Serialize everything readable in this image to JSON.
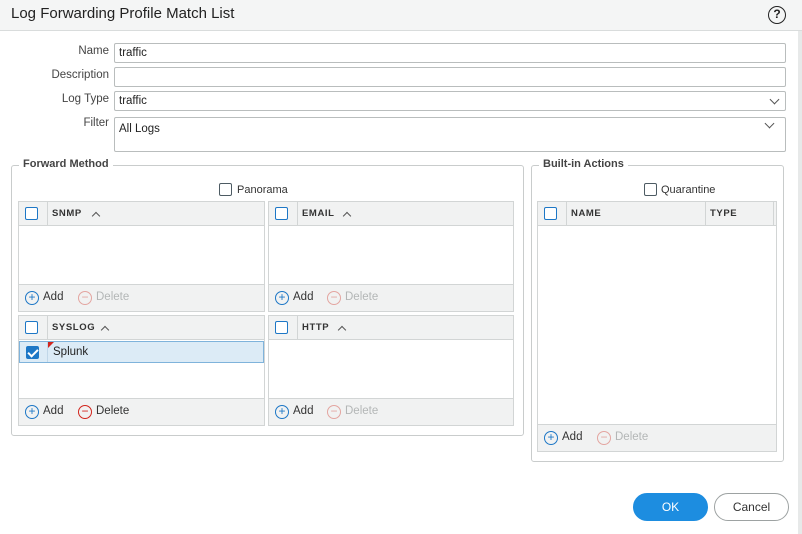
{
  "dialog": {
    "title": "Log Forwarding Profile Match List",
    "help_icon": "help-circle-icon"
  },
  "form": {
    "name_label": "Name",
    "name_value": "traffic",
    "description_label": "Description",
    "description_value": "",
    "log_type_label": "Log Type",
    "log_type_value": "traffic",
    "filter_label": "Filter",
    "filter_value": "All Logs"
  },
  "forward_method": {
    "legend": "Forward Method",
    "panorama_label": "Panorama",
    "panorama_checked": false,
    "panels": {
      "snmp": {
        "header": "SNMP",
        "rows": [],
        "add_label": "Add",
        "delete_label": "Delete"
      },
      "email": {
        "header": "EMAIL",
        "rows": [],
        "add_label": "Add",
        "delete_label": "Delete"
      },
      "syslog": {
        "header": "SYSLOG",
        "rows": [
          {
            "name": "Splunk",
            "checked": true
          }
        ],
        "add_label": "Add",
        "delete_label": "Delete"
      },
      "http": {
        "header": "HTTP",
        "rows": [],
        "add_label": "Add",
        "delete_label": "Delete"
      }
    }
  },
  "builtin_actions": {
    "legend": "Built-in Actions",
    "quarantine_label": "Quarantine",
    "quarantine_checked": false,
    "columns": [
      "NAME",
      "TYPE"
    ],
    "rows": [],
    "add_label": "Add",
    "delete_label": "Delete"
  },
  "buttons": {
    "ok": "OK",
    "cancel": "Cancel"
  },
  "colors": {
    "accent": "#1d8de0",
    "delete_red": "#d2251d",
    "selected_row": "#dcebf6"
  }
}
